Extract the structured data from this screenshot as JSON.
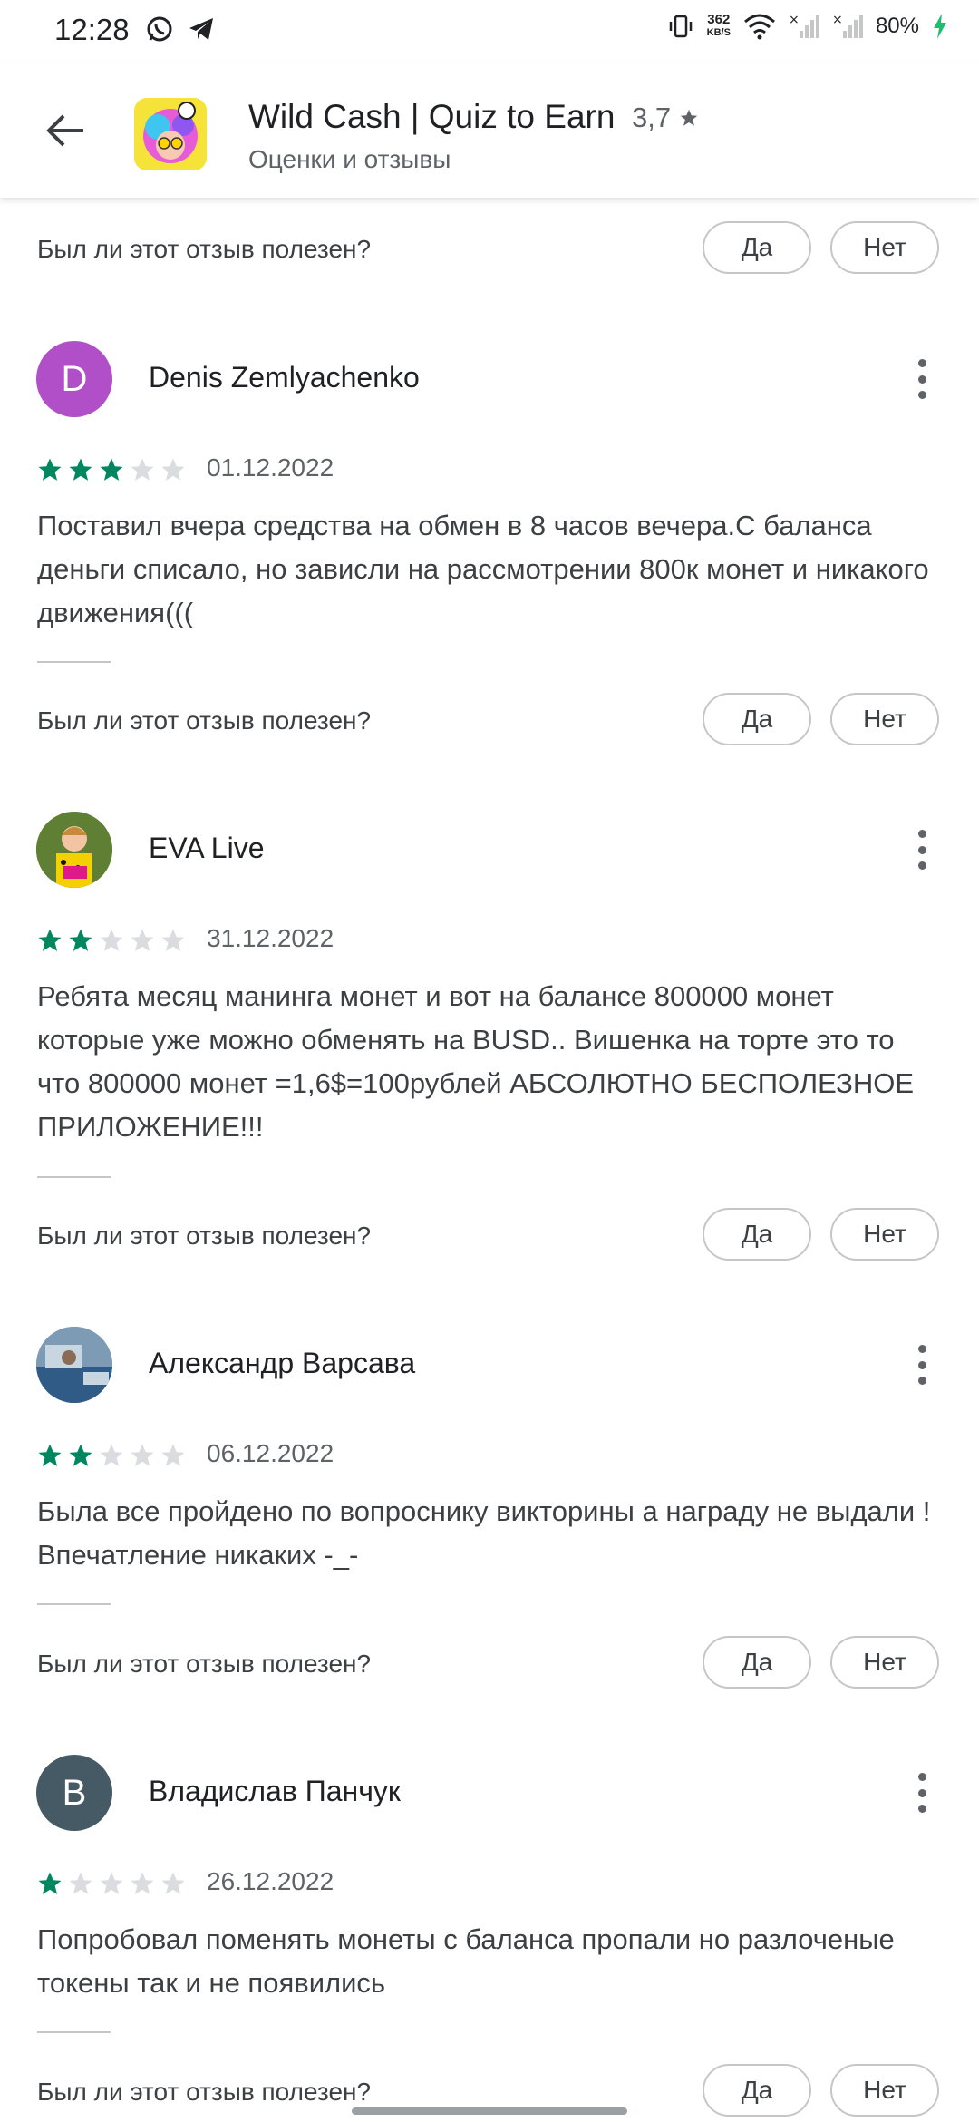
{
  "status_bar": {
    "time": "12:28",
    "speed_value": "362",
    "speed_unit": "KB/S",
    "battery": "80%",
    "icons": [
      "whatsapp-icon",
      "telegram-icon",
      "vibrate-icon",
      "wifi-icon",
      "signal-icon",
      "battery-charging-icon"
    ]
  },
  "header": {
    "title": "Wild Cash | Quiz to Earn",
    "rating": "3,7",
    "subtitle": "Оценки и отзывы"
  },
  "helpful": {
    "question": "Был ли этот отзыв полезен?",
    "yes": "Да",
    "no": "Нет"
  },
  "reviews": [
    {
      "author": "Denis Zemlyachenko",
      "avatar_letter": "D",
      "avatar_color": "#b04fc7",
      "stars": 3,
      "date": "01.12.2022",
      "text": "Поставил вчера средства на обмен в 8 часов вечера.С баланса деньги списало, но зависли на рассмотрении 800к монет и никакого движения((("
    },
    {
      "author": "EVA Live",
      "avatar_letter": "",
      "stars": 2,
      "date": "31.12.2022",
      "text": "Ребята месяц манинга монет и вот на балансе 800000 монет которые уже можно обменять на BUSD.. Вишенка на торте это то что 800000 монет =1,6$=100рублей АБСОЛЮТНО БЕСПОЛЕЗНОЕ ПРИЛОЖЕНИЕ!!!"
    },
    {
      "author": "Александр Варсава",
      "avatar_letter": "",
      "stars": 2,
      "date": "06.12.2022",
      "text": "Была все пройдено по вопроснику викторины а награду не выдали ! Впечатление никаких -_-"
    },
    {
      "author": "Владислав Панчук",
      "avatar_letter": "В",
      "avatar_color": "#455a64",
      "stars": 1,
      "date": "26.12.2022",
      "text": "Попробовал поменять монеты с баланса пропали но разлоченые токены так и не появились"
    }
  ],
  "colors": {
    "star_filled": "#01875f",
    "star_empty": "#dadce0",
    "text_secondary": "#5f6368"
  }
}
